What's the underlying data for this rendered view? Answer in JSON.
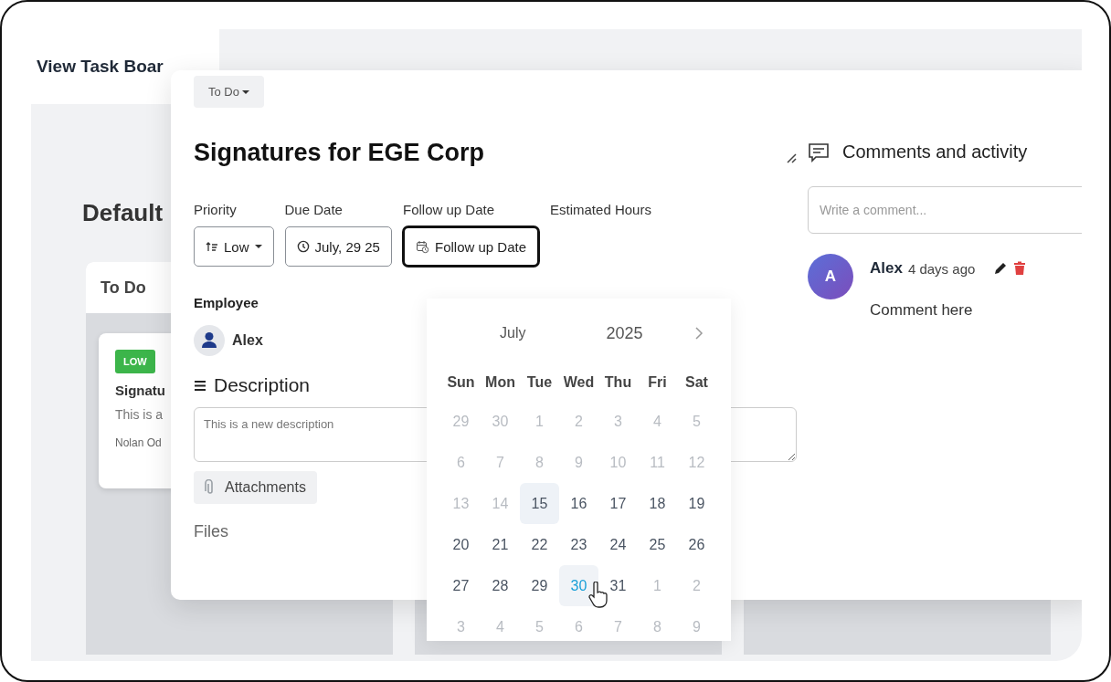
{
  "board": {
    "title": "View Task Boar",
    "heading": "Default",
    "columns": [
      {
        "title": "To Do",
        "cards": [
          {
            "priority": "LOW",
            "title": "Signatu",
            "description": "This is a",
            "assignee": "Nolan Od"
          }
        ]
      }
    ]
  },
  "task": {
    "status": "To Do",
    "title": "Signatures for EGE Corp",
    "fields": [
      {
        "label": "Priority",
        "kind": "select",
        "value": "Low",
        "focused": false
      },
      {
        "label": "Due Date",
        "kind": "date",
        "value": "July, 29 25",
        "focused": false
      },
      {
        "label": "Follow up Date",
        "kind": "followup",
        "placeholder": "Follow up Date",
        "focused": true
      },
      {
        "label": "Estimated Hours",
        "kind": "empty"
      }
    ],
    "employee": {
      "label": "Employee",
      "name": "Alex"
    },
    "description": {
      "label": "Description",
      "placeholder": "This is a new description"
    },
    "attachments_button": "Attachments",
    "files_label": "Files"
  },
  "calendar": {
    "month": "July",
    "year": "2025",
    "weekdays": [
      "Sun",
      "Mon",
      "Tue",
      "Wed",
      "Thu",
      "Fri",
      "Sat"
    ],
    "weeks": [
      [
        {
          "label": "29",
          "disabled": true,
          "today": false,
          "selected": false
        },
        {
          "label": "30",
          "disabled": true,
          "today": false,
          "selected": false
        },
        {
          "label": "1",
          "disabled": true,
          "today": false,
          "selected": false
        },
        {
          "label": "2",
          "disabled": true,
          "today": false,
          "selected": false
        },
        {
          "label": "3",
          "disabled": true,
          "today": false,
          "selected": false
        },
        {
          "label": "4",
          "disabled": true,
          "today": false,
          "selected": false
        },
        {
          "label": "5",
          "disabled": true,
          "today": false,
          "selected": false
        }
      ],
      [
        {
          "label": "6",
          "disabled": true,
          "today": false,
          "selected": false
        },
        {
          "label": "7",
          "disabled": true,
          "today": false,
          "selected": false
        },
        {
          "label": "8",
          "disabled": true,
          "today": false,
          "selected": false
        },
        {
          "label": "9",
          "disabled": true,
          "today": false,
          "selected": false
        },
        {
          "label": "10",
          "disabled": true,
          "today": false,
          "selected": false
        },
        {
          "label": "11",
          "disabled": true,
          "today": false,
          "selected": false
        },
        {
          "label": "12",
          "disabled": true,
          "today": false,
          "selected": false
        }
      ],
      [
        {
          "label": "13",
          "disabled": true,
          "today": false,
          "selected": false
        },
        {
          "label": "14",
          "disabled": true,
          "today": false,
          "selected": false
        },
        {
          "label": "15",
          "disabled": false,
          "today": true,
          "selected": false
        },
        {
          "label": "16",
          "disabled": false,
          "today": false,
          "selected": false
        },
        {
          "label": "17",
          "disabled": false,
          "today": false,
          "selected": false
        },
        {
          "label": "18",
          "disabled": false,
          "today": false,
          "selected": false
        },
        {
          "label": "19",
          "disabled": false,
          "today": false,
          "selected": false
        }
      ],
      [
        {
          "label": "20",
          "disabled": false,
          "today": false,
          "selected": false
        },
        {
          "label": "21",
          "disabled": false,
          "today": false,
          "selected": false
        },
        {
          "label": "22",
          "disabled": false,
          "today": false,
          "selected": false
        },
        {
          "label": "23",
          "disabled": false,
          "today": false,
          "selected": false
        },
        {
          "label": "24",
          "disabled": false,
          "today": false,
          "selected": false
        },
        {
          "label": "25",
          "disabled": false,
          "today": false,
          "selected": false
        },
        {
          "label": "26",
          "disabled": false,
          "today": false,
          "selected": false
        }
      ],
      [
        {
          "label": "27",
          "disabled": false,
          "today": false,
          "selected": false
        },
        {
          "label": "28",
          "disabled": false,
          "today": false,
          "selected": false
        },
        {
          "label": "29",
          "disabled": false,
          "today": false,
          "selected": false
        },
        {
          "label": "30",
          "disabled": false,
          "today": false,
          "selected": true
        },
        {
          "label": "31",
          "disabled": false,
          "today": false,
          "selected": false
        },
        {
          "label": "1",
          "disabled": true,
          "today": false,
          "selected": false
        },
        {
          "label": "2",
          "disabled": true,
          "today": false,
          "selected": false
        }
      ],
      [
        {
          "label": "3",
          "disabled": true,
          "today": false,
          "selected": false
        },
        {
          "label": "4",
          "disabled": true,
          "today": false,
          "selected": false
        },
        {
          "label": "5",
          "disabled": true,
          "today": false,
          "selected": false
        },
        {
          "label": "6",
          "disabled": true,
          "today": false,
          "selected": false
        },
        {
          "label": "7",
          "disabled": true,
          "today": false,
          "selected": false
        },
        {
          "label": "8",
          "disabled": true,
          "today": false,
          "selected": false
        },
        {
          "label": "9",
          "disabled": true,
          "today": false,
          "selected": false
        }
      ]
    ]
  },
  "comments": {
    "title": "Comments and activity",
    "placeholder": "Write a comment...",
    "items": [
      {
        "initial": "A",
        "author": "Alex",
        "time": "4 days ago",
        "text": "Comment here"
      }
    ]
  }
}
